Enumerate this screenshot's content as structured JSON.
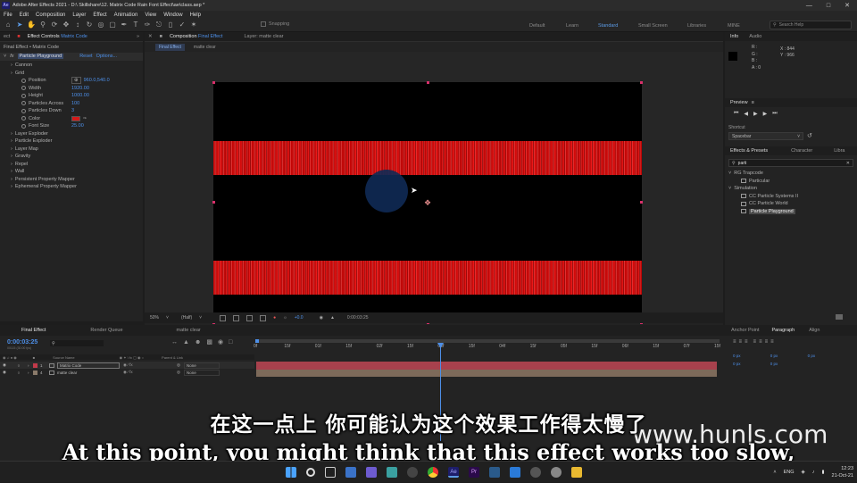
{
  "titlebar": {
    "title": "Adobe After Effects 2021 - D:\\ Skillshare\\12. Matrix Code Rain Font Effect\\ae\\class.aep *"
  },
  "menubar": {
    "items": [
      "File",
      "Edit",
      "Composition",
      "Layer",
      "Effect",
      "Animation",
      "View",
      "Window",
      "Help"
    ]
  },
  "toolbar": {
    "snapping_label": "Snapping",
    "workspaces": [
      "Default",
      "Learn",
      "Standard",
      "Small Screen",
      "Libraries",
      "MINE"
    ],
    "active_workspace": "Standard",
    "search_placeholder": "Search Help"
  },
  "effect_controls": {
    "tab_prefix": "ect",
    "tab_title": "Effect Controls",
    "tab_layer": "Matrix Code",
    "breadcrumb": "Final Effect • Matrix Code",
    "effect_name": "Particle Playground",
    "reset_label": "Reset",
    "options_label": "Options...",
    "rows": [
      {
        "label": "Cannon",
        "indent": 1
      },
      {
        "label": "Grid",
        "indent": 1
      },
      {
        "label": "Position",
        "indent": 3,
        "value": "960.0,540.0",
        "stopwatch": true,
        "crosshair": true
      },
      {
        "label": "Width",
        "indent": 3,
        "value": "1920.00",
        "stopwatch": true
      },
      {
        "label": "Height",
        "indent": 3,
        "value": "1000.00",
        "stopwatch": true
      },
      {
        "label": "Particles Across",
        "indent": 3,
        "value": "100",
        "stopwatch": true
      },
      {
        "label": "Particles Down",
        "indent": 3,
        "value": "3",
        "stopwatch": true
      },
      {
        "label": "Color",
        "indent": 3,
        "value": "",
        "stopwatch": true,
        "swatch": "#d41a1a"
      },
      {
        "label": "Font Size",
        "indent": 3,
        "value": "25.00",
        "stopwatch": true
      },
      {
        "label": "Layer Exploder",
        "indent": 1
      },
      {
        "label": "Particle Exploder",
        "indent": 1
      },
      {
        "label": "Layer Map",
        "indent": 1
      },
      {
        "label": "Gravity",
        "indent": 1
      },
      {
        "label": "Repel",
        "indent": 1
      },
      {
        "label": "Wall",
        "indent": 1
      },
      {
        "label": "Persistent Property Mapper",
        "indent": 1
      },
      {
        "label": "Ephemeral Property Mapper",
        "indent": 1
      }
    ]
  },
  "composition": {
    "tab_title": "Composition",
    "tab_comp": "Final Effect",
    "layer_tab": "Layer: matte clear",
    "subtabs": [
      "Final Effect",
      "matte clear"
    ],
    "footer": {
      "zoom": "50%",
      "resolution": "(Half)",
      "exposure": "+0.0",
      "timecode": "0:00:03:25"
    }
  },
  "info_panel": {
    "tabs": [
      "Info",
      "Audio"
    ],
    "r": "R :",
    "g": "G :",
    "b": "B :",
    "a": "A :  0",
    "x": "X : 844",
    "y": "Y : 966"
  },
  "preview_panel": {
    "title": "Preview",
    "shortcut_label": "Shortcut",
    "shortcut_value": "Spacebar"
  },
  "effects_presets": {
    "tabs": [
      "Effects & Presets",
      "Character",
      "Libra"
    ],
    "search_value": "parti",
    "items": [
      {
        "label": "RG Trapcode",
        "type": "folder",
        "indent": 0
      },
      {
        "label": "Particular",
        "type": "effect",
        "indent": 1
      },
      {
        "label": "Simulation",
        "type": "folder",
        "indent": 0
      },
      {
        "label": "CC Particle Systems II",
        "type": "effect",
        "indent": 1
      },
      {
        "label": "CC Particle World",
        "type": "effect",
        "indent": 1
      },
      {
        "label": "Particle Playground",
        "type": "effect",
        "indent": 1,
        "selected": true
      }
    ]
  },
  "timeline": {
    "tabs": [
      "Final Effect",
      "Render Queue",
      "matte clear"
    ],
    "timecode": "0:00:03:25",
    "timecode_sub": "00115 (30.00 fps)",
    "columns": {
      "source_name": "Source Name",
      "parent": "Parent & Link"
    },
    "layers": [
      {
        "num": "1",
        "name": "Matrix Code",
        "color": "#c23a4a",
        "parent": "None"
      },
      {
        "num": "4",
        "name": "matte clear",
        "color": "#8a7a6a",
        "parent": "None"
      }
    ],
    "ruler_ticks": [
      "0f",
      "15f",
      "01f",
      "15f",
      "02f",
      "15f",
      "03f",
      "15f",
      "04f",
      "15f",
      "05f",
      "15f",
      "06f",
      "15f",
      "07f",
      "15f"
    ]
  },
  "align_panel": {
    "tabs": [
      "Anchor Point",
      "Paragraph",
      "Align"
    ],
    "active": "Paragraph",
    "values": [
      "0 px",
      "0 px",
      "0 px",
      "0 px",
      "0 px"
    ]
  },
  "subtitles": {
    "chinese": "在这一点上 你可能认为这个效果工作得太慢了",
    "english": "At this point, you might think that this effect works too slow,"
  },
  "watermark": "www.hunls.com",
  "taskbar": {
    "lang": "ENG",
    "time": "12:23",
    "date": "21-Oct-21"
  }
}
